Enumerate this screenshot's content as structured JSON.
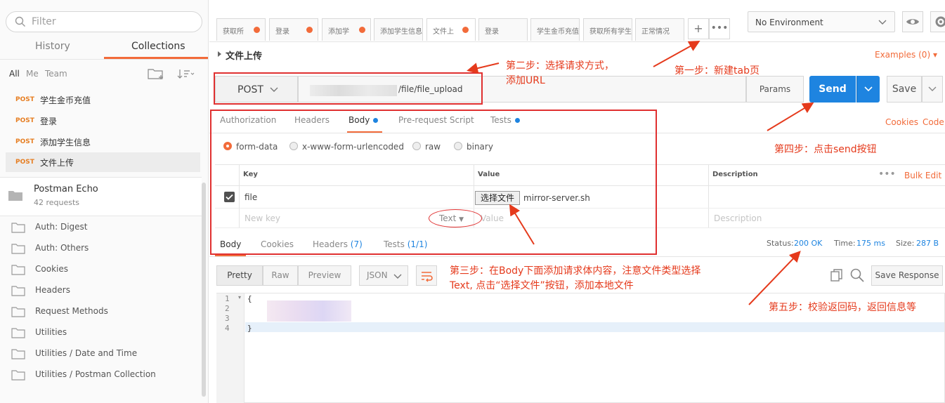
{
  "sidebar": {
    "filter_placeholder": "Filter",
    "tabs": {
      "history": "History",
      "collections": "Collections"
    },
    "scopes": [
      "All",
      "Me",
      "Team"
    ],
    "requests": [
      {
        "method": "POST",
        "name": "学生金币充值"
      },
      {
        "method": "POST",
        "name": "登录"
      },
      {
        "method": "POST",
        "name": "添加学生信息"
      },
      {
        "method": "POST",
        "name": "文件上传"
      }
    ],
    "collection": {
      "name": "Postman Echo",
      "count": "42 requests"
    },
    "folders": [
      "Auth: Digest",
      "Auth: Others",
      "Cookies",
      "Headers",
      "Request Methods",
      "Utilities",
      "Utilities / Date and Time",
      "Utilities / Postman Collection"
    ]
  },
  "tabbar": {
    "tabs": [
      "获取所",
      "登录",
      "添加学",
      "添加学生信息",
      "文件上",
      "登录",
      "学生金币充值",
      "获取所有学生",
      "正常情况"
    ],
    "plus": "+",
    "more": "•••",
    "environment": "No Environment"
  },
  "request": {
    "title": "文件上传",
    "examples": "Examples (0)",
    "method": "POST",
    "url_suffix": "/file/file_upload",
    "params": "Params",
    "send": "Send",
    "save": "Save",
    "subtabs": [
      "Authorization",
      "Headers",
      "Body",
      "Pre-request Script",
      "Tests"
    ],
    "cookies": "Cookies",
    "code": "Code",
    "body_modes": [
      "form-data",
      "x-www-form-urlencoded",
      "raw",
      "binary"
    ],
    "kv_headers": {
      "key": "Key",
      "value": "Value",
      "description": "Description"
    },
    "bulk_edit": "Bulk Edit",
    "row": {
      "key": "file",
      "choose": "选择文件",
      "file_name": "mirror-server.sh"
    },
    "new_row": {
      "key": "New key",
      "type": "Text",
      "value": "Value",
      "description": "Description"
    }
  },
  "response": {
    "tabs": [
      "Body",
      "Cookies",
      "Headers",
      "Tests"
    ],
    "headers_count": "(7)",
    "tests_count": "(1/1)",
    "status_label": "Status:",
    "status": "200 OK",
    "time_label": "Time:",
    "time": "175 ms",
    "size_label": "Size:",
    "size": "287 B",
    "formats": [
      "Pretty",
      "Raw",
      "Preview"
    ],
    "lang": "JSON",
    "save_response": "Save Response",
    "lines": [
      "1",
      "2",
      "3",
      "4"
    ],
    "code": [
      "{",
      "",
      "",
      "}"
    ]
  },
  "annotations": {
    "step1": "第一步：新建tab页",
    "step2a": "第二步：选择请求方式，",
    "step2b": "添加URL",
    "step3a": "第三步：在Body下面添加请求体内容，注意文件类型选择",
    "step3b": "Text, 点击“选择文件”按钮，添加本地文件",
    "step4": "第四步：点击send按钮",
    "step5": "第五步：校验返回码，返回信息等"
  },
  "colors": {
    "accent": "#f26b3a",
    "send": "#1e84e0",
    "annotation": "#e53a1c"
  }
}
